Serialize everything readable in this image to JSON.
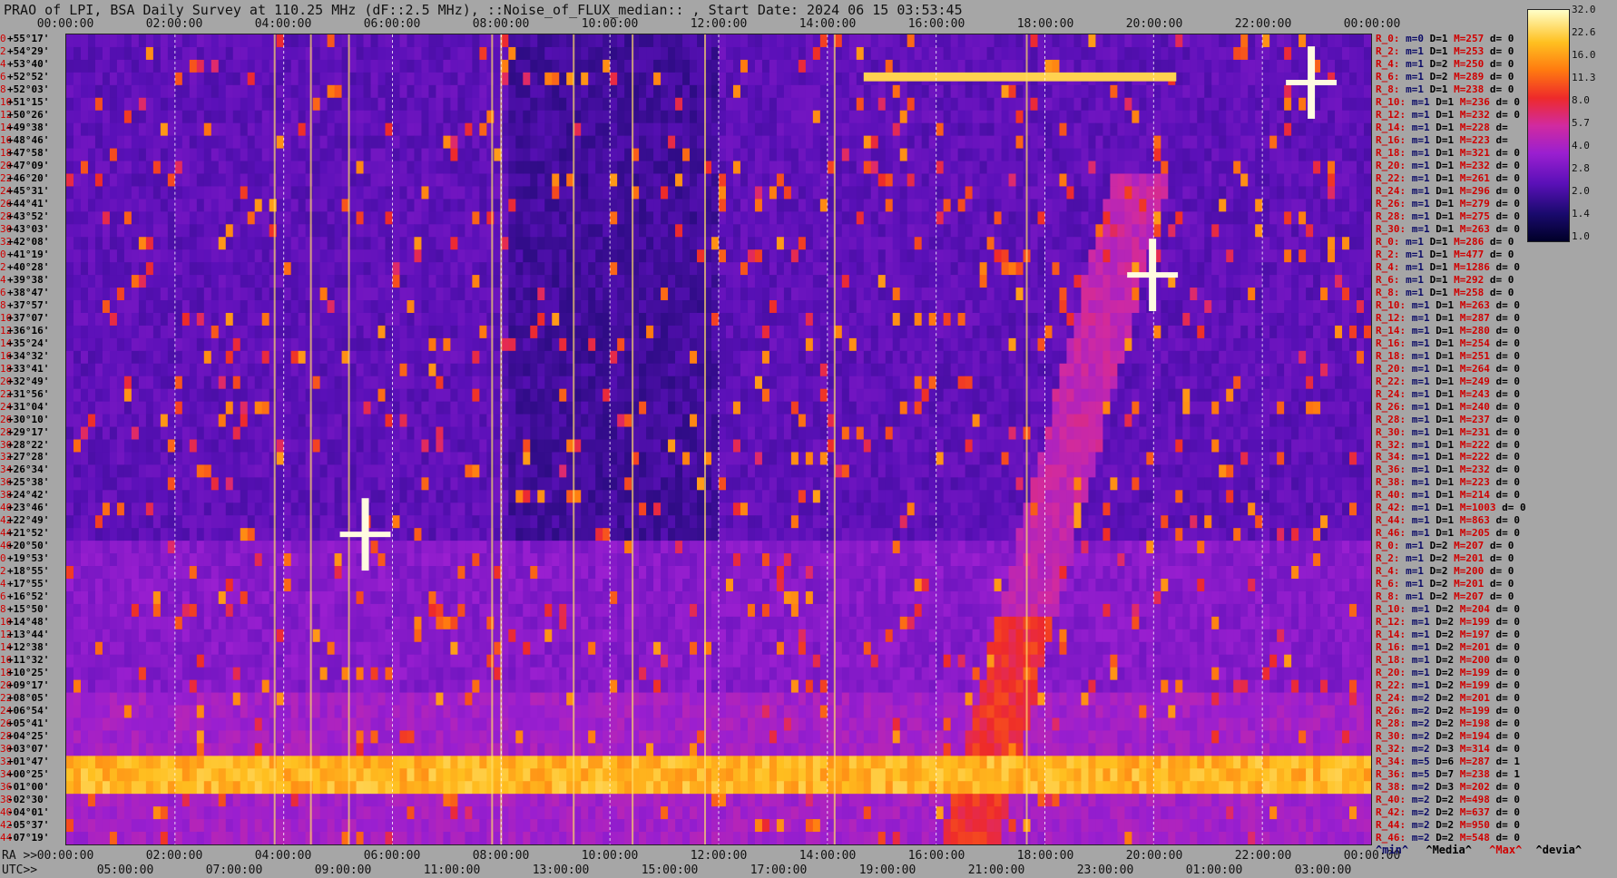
{
  "title": "PRAO of LPI, BSA Daily Survey at 110.25 MHz (dF::2.5 MHz), ::Noise_of_FLUX_median:: , Start Date: 2024 06 15 03:53:45",
  "ra_prefix": "RA >>",
  "utc_prefix": "UTC>>",
  "top_ticks": [
    "00:00:00",
    "02:00:00",
    "04:00:00",
    "06:00:00",
    "08:00:00",
    "10:00:00",
    "12:00:00",
    "14:00:00",
    "16:00:00",
    "18:00:00",
    "20:00:00",
    "22:00:00",
    "00:00:00"
  ],
  "bottom_ra_ticks": [
    "00:00:00",
    "02:00:00",
    "04:00:00",
    "06:00:00",
    "08:00:00",
    "10:00:00",
    "12:00:00",
    "14:00:00",
    "16:00:00",
    "18:00:00",
    "20:00:00",
    "22:00:00",
    "00:00:00"
  ],
  "bottom_utc_ticks": [
    "05:00:00",
    "07:00:00",
    "09:00:00",
    "11:00:00",
    "13:00:00",
    "15:00:00",
    "17:00:00",
    "19:00:00",
    "21:00:00",
    "23:00:00",
    "01:00:00",
    "03:00:00"
  ],
  "legend": {
    "min": "^min^",
    "median": "^Media^",
    "max": "^Max^",
    "dev": "^devia^"
  },
  "colorbar_labels": [
    "32.0",
    "22.6",
    "16.0",
    "11.3",
    "8.0",
    "5.7",
    "4.0",
    "2.8",
    "2.0",
    "1.4",
    "1.0"
  ],
  "colors": {
    "background": "#a6a6a6",
    "accent_red": "#d00000",
    "navy": "#0a0a66"
  },
  "chart_data": {
    "type": "heatmap",
    "title": "PRAO of LPI, BSA Daily Survey at 110.25 MHz (dF::2.5 MHz), ::Noise_of_FLUX_median:: , Start Date: 2024 06 15 03:53:45",
    "x_axis_top": "RA 00:00:00 to 24:00:00",
    "x_axis_bottom": "UTC 05:00:00 to 03:00:00",
    "colorbar": [
      32.0,
      22.6,
      16.0,
      11.3,
      8.0,
      5.7,
      4.0,
      2.8,
      2.0,
      1.4,
      1.0
    ],
    "declinations": [
      "+55°17'",
      "+54°29'",
      "+53°40'",
      "+52°52'",
      "+52°03'",
      "+51°15'",
      "+50°26'",
      "+49°38'",
      "+48°46'",
      "+47°58'",
      "+47°09'",
      "+46°20'",
      "+45°31'",
      "+44°41'",
      "+43°52'",
      "+43°03'",
      "+42°08'",
      "+41°19'",
      "+40°28'",
      "+39°38'",
      "+38°47'",
      "+37°57'",
      "+37°07'",
      "+36°16'",
      "+35°24'",
      "+34°32'",
      "+33°41'",
      "+32°49'",
      "+31°56'",
      "+31°04'",
      "+30°10'",
      "+29°17'",
      "+28°22'",
      "+27°28'",
      "+26°34'",
      "+25°38'",
      "+24°42'",
      "+23°46'",
      "+22°49'",
      "+21°52'",
      "+20°50'",
      "+19°53'",
      "+18°55'",
      "+17°55'",
      "+16°52'",
      "+15°50'",
      "+14°48'",
      "+13°44'",
      "+12°38'",
      "+11°32'",
      "+10°25'",
      "+09°17'",
      "+08°05'",
      "+06°54'",
      "+05°41'",
      "+04°25'",
      "+03°07'",
      "+01°47'",
      "+00°25'",
      "-01°00'",
      "-02°30'",
      "-04°01'",
      "-05°37'",
      "-07°19'"
    ],
    "row_indices": [
      "0",
      "2",
      "4",
      "6",
      "8",
      "10",
      "12",
      "14",
      "16",
      "18",
      "20",
      "22",
      "24",
      "26",
      "28",
      "30",
      "32",
      "0",
      "2",
      "4",
      "6",
      "8",
      "10",
      "12",
      "14",
      "16",
      "18",
      "20",
      "22",
      "24",
      "26",
      "28",
      "30",
      "32",
      "34",
      "36",
      "38",
      "40",
      "42",
      "44",
      "46",
      "0",
      "2",
      "4",
      "6",
      "8",
      "10",
      "12",
      "14",
      "16",
      "18",
      "20",
      "22",
      "24",
      "26",
      "28",
      "30",
      "32",
      "34",
      "36",
      "38",
      "40",
      "42",
      "44"
    ],
    "stats": [
      {
        "r": "R_0:",
        "m": "m=0",
        "D": "D=1",
        "M": "M=257",
        "d": "d= 0"
      },
      {
        "r": "R_2:",
        "m": "m=1",
        "D": "D=1",
        "M": "M=253",
        "d": "d= 0"
      },
      {
        "r": "R_4:",
        "m": "m=1",
        "D": "D=2",
        "M": "M=250",
        "d": "d= 0"
      },
      {
        "r": "R_6:",
        "m": "m=1",
        "D": "D=2",
        "M": "M=289",
        "d": "d= 0"
      },
      {
        "r": "R_8:",
        "m": "m=1",
        "D": "D=1",
        "M": "M=238",
        "d": "d= 0"
      },
      {
        "r": "R_10:",
        "m": "m=1",
        "D": "D=1",
        "M": "M=236",
        "d": "d= 0"
      },
      {
        "r": "R_12:",
        "m": "m=1",
        "D": "D=1",
        "M": "M=232",
        "d": "d= 0"
      },
      {
        "r": "R_14:",
        "m": "m=1",
        "D": "D=1",
        "M": "M=228",
        "d": "d="
      },
      {
        "r": "R_16:",
        "m": "m=1",
        "D": "D=1",
        "M": "M=223",
        "d": "d="
      },
      {
        "r": "R_18:",
        "m": "m=1",
        "D": "D=1",
        "M": "M=321",
        "d": "d= 0"
      },
      {
        "r": "R_20:",
        "m": "m=1",
        "D": "D=1",
        "M": "M=232",
        "d": "d= 0"
      },
      {
        "r": "R_22:",
        "m": "m=1",
        "D": "D=1",
        "M": "M=261",
        "d": "d= 0"
      },
      {
        "r": "R_24:",
        "m": "m=1",
        "D": "D=1",
        "M": "M=296",
        "d": "d= 0"
      },
      {
        "r": "R_26:",
        "m": "m=1",
        "D": "D=1",
        "M": "M=279",
        "d": "d= 0"
      },
      {
        "r": "R_28:",
        "m": "m=1",
        "D": "D=1",
        "M": "M=275",
        "d": "d= 0"
      },
      {
        "r": "R_30:",
        "m": "m=1",
        "D": "D=1",
        "M": "M=263",
        "d": "d= 0"
      },
      {
        "r": "R_0:",
        "m": "m=1",
        "D": "D=1",
        "M": "M=286",
        "d": "d= 0"
      },
      {
        "r": "R_2:",
        "m": "m=1",
        "D": "D=1",
        "M": "M=477",
        "d": "d= 0"
      },
      {
        "r": "R_4:",
        "m": "m=1",
        "D": "D=1",
        "M": "M=1286",
        "d": "d= 0"
      },
      {
        "r": "R_6:",
        "m": "m=1",
        "D": "D=1",
        "M": "M=292",
        "d": "d= 0"
      },
      {
        "r": "R_8:",
        "m": "m=1",
        "D": "D=1",
        "M": "M=258",
        "d": "d= 0"
      },
      {
        "r": "R_10:",
        "m": "m=1",
        "D": "D=1",
        "M": "M=263",
        "d": "d= 0"
      },
      {
        "r": "R_12:",
        "m": "m=1",
        "D": "D=1",
        "M": "M=287",
        "d": "d= 0"
      },
      {
        "r": "R_14:",
        "m": "m=1",
        "D": "D=1",
        "M": "M=280",
        "d": "d= 0"
      },
      {
        "r": "R_16:",
        "m": "m=1",
        "D": "D=1",
        "M": "M=254",
        "d": "d= 0"
      },
      {
        "r": "R_18:",
        "m": "m=1",
        "D": "D=1",
        "M": "M=251",
        "d": "d= 0"
      },
      {
        "r": "R_20:",
        "m": "m=1",
        "D": "D=1",
        "M": "M=264",
        "d": "d= 0"
      },
      {
        "r": "R_22:",
        "m": "m=1",
        "D": "D=1",
        "M": "M=249",
        "d": "d= 0"
      },
      {
        "r": "R_24:",
        "m": "m=1",
        "D": "D=1",
        "M": "M=243",
        "d": "d= 0"
      },
      {
        "r": "R_26:",
        "m": "m=1",
        "D": "D=1",
        "M": "M=240",
        "d": "d= 0"
      },
      {
        "r": "R_28:",
        "m": "m=1",
        "D": "D=1",
        "M": "M=237",
        "d": "d= 0"
      },
      {
        "r": "R_30:",
        "m": "m=1",
        "D": "D=1",
        "M": "M=231",
        "d": "d= 0"
      },
      {
        "r": "R_32:",
        "m": "m=1",
        "D": "D=1",
        "M": "M=222",
        "d": "d= 0"
      },
      {
        "r": "R_34:",
        "m": "m=1",
        "D": "D=1",
        "M": "M=222",
        "d": "d= 0"
      },
      {
        "r": "R_36:",
        "m": "m=1",
        "D": "D=1",
        "M": "M=232",
        "d": "d= 0"
      },
      {
        "r": "R_38:",
        "m": "m=1",
        "D": "D=1",
        "M": "M=223",
        "d": "d= 0"
      },
      {
        "r": "R_40:",
        "m": "m=1",
        "D": "D=1",
        "M": "M=214",
        "d": "d= 0"
      },
      {
        "r": "R_42:",
        "m": "m=1",
        "D": "D=1",
        "M": "M=1003",
        "d": "d= 0"
      },
      {
        "r": "R_44:",
        "m": "m=1",
        "D": "D=1",
        "M": "M=863",
        "d": "d= 0"
      },
      {
        "r": "R_46:",
        "m": "m=1",
        "D": "D=1",
        "M": "M=205",
        "d": "d= 0"
      },
      {
        "r": "R_0:",
        "m": "m=1",
        "D": "D=2",
        "M": "M=207",
        "d": "d= 0"
      },
      {
        "r": "R_2:",
        "m": "m=1",
        "D": "D=2",
        "M": "M=201",
        "d": "d= 0"
      },
      {
        "r": "R_4:",
        "m": "m=1",
        "D": "D=2",
        "M": "M=200",
        "d": "d= 0"
      },
      {
        "r": "R_6:",
        "m": "m=1",
        "D": "D=2",
        "M": "M=201",
        "d": "d= 0"
      },
      {
        "r": "R_8:",
        "m": "m=1",
        "D": "D=2",
        "M": "M=207",
        "d": "d= 0"
      },
      {
        "r": "R_10:",
        "m": "m=1",
        "D": "D=2",
        "M": "M=204",
        "d": "d= 0"
      },
      {
        "r": "R_12:",
        "m": "m=1",
        "D": "D=2",
        "M": "M=199",
        "d": "d= 0"
      },
      {
        "r": "R_14:",
        "m": "m=1",
        "D": "D=2",
        "M": "M=197",
        "d": "d= 0"
      },
      {
        "r": "R_16:",
        "m": "m=1",
        "D": "D=2",
        "M": "M=201",
        "d": "d= 0"
      },
      {
        "r": "R_18:",
        "m": "m=1",
        "D": "D=2",
        "M": "M=200",
        "d": "d= 0"
      },
      {
        "r": "R_20:",
        "m": "m=1",
        "D": "D=2",
        "M": "M=199",
        "d": "d= 0"
      },
      {
        "r": "R_22:",
        "m": "m=1",
        "D": "D=2",
        "M": "M=199",
        "d": "d= 0"
      },
      {
        "r": "R_24:",
        "m": "m=2",
        "D": "D=2",
        "M": "M=201",
        "d": "d= 0"
      },
      {
        "r": "R_26:",
        "m": "m=2",
        "D": "D=2",
        "M": "M=199",
        "d": "d= 0"
      },
      {
        "r": "R_28:",
        "m": "m=2",
        "D": "D=2",
        "M": "M=198",
        "d": "d= 0"
      },
      {
        "r": "R_30:",
        "m": "m=2",
        "D": "D=2",
        "M": "M=194",
        "d": "d= 0"
      },
      {
        "r": "R_32:",
        "m": "m=2",
        "D": "D=3",
        "M": "M=314",
        "d": "d= 0"
      },
      {
        "r": "R_34:",
        "m": "m=5",
        "D": "D=6",
        "M": "M=287",
        "d": "d= 1"
      },
      {
        "r": "R_36:",
        "m": "m=5",
        "D": "D=7",
        "M": "M=238",
        "d": "d= 1"
      },
      {
        "r": "R_38:",
        "m": "m=2",
        "D": "D=3",
        "M": "M=202",
        "d": "d= 0"
      },
      {
        "r": "R_40:",
        "m": "m=2",
        "D": "D=2",
        "M": "M=498",
        "d": "d= 0"
      },
      {
        "r": "R_42:",
        "m": "m=2",
        "D": "D=2",
        "M": "M=637",
        "d": "d= 0"
      },
      {
        "r": "R_44:",
        "m": "m=2",
        "D": "D=2",
        "M": "M=950",
        "d": "d= 0"
      },
      {
        "r": "R_46:",
        "m": "m=2",
        "D": "D=2",
        "M": "M=548",
        "d": "d= 0"
      }
    ],
    "bright_sources": [
      {
        "ra_h": 5.5,
        "dec": "+21°52'",
        "level": 32.0
      },
      {
        "ra_h": 19.98,
        "dec": "+40°44'",
        "level": 32.0
      },
      {
        "ra_h": 22.9,
        "dec": "+52°52'",
        "level": 16.0
      }
    ]
  }
}
